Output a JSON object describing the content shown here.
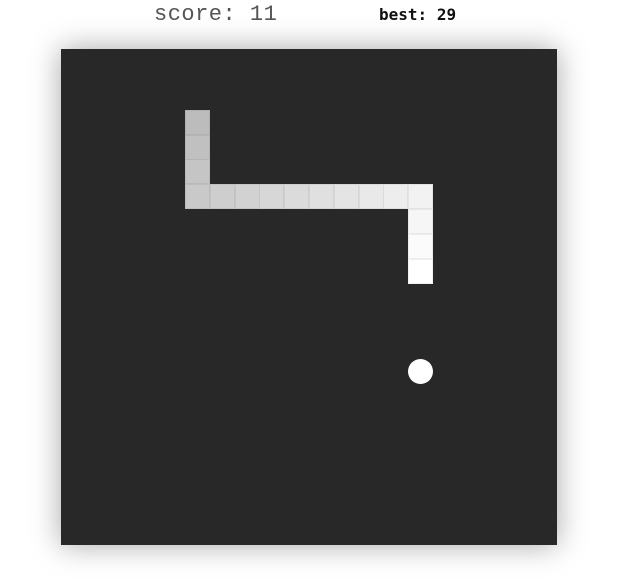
{
  "scoreboard": {
    "score_label": "score:",
    "score_value": "11",
    "best_label": "best:",
    "best_value": "29"
  },
  "game": {
    "colors": {
      "board": "#282828",
      "head": "#ffffff",
      "tail": "#bcbcbc",
      "food": "#ffffff"
    },
    "grid_size": 20,
    "snake_cells": [
      [
        14,
        12
      ],
      [
        14,
        11
      ],
      [
        14,
        9
      ],
      [
        13,
        9
      ],
      [
        12,
        9
      ],
      [
        11,
        9
      ],
      [
        10,
        9
      ],
      [
        9,
        9
      ],
      [
        8,
        9
      ],
      [
        7,
        9
      ],
      [
        6,
        9
      ],
      [
        5,
        9
      ],
      [
        5,
        8
      ],
      [
        5,
        7
      ],
      [
        5,
        6
      ]
    ],
    "food_cell": [
      14,
      14
    ]
  }
}
